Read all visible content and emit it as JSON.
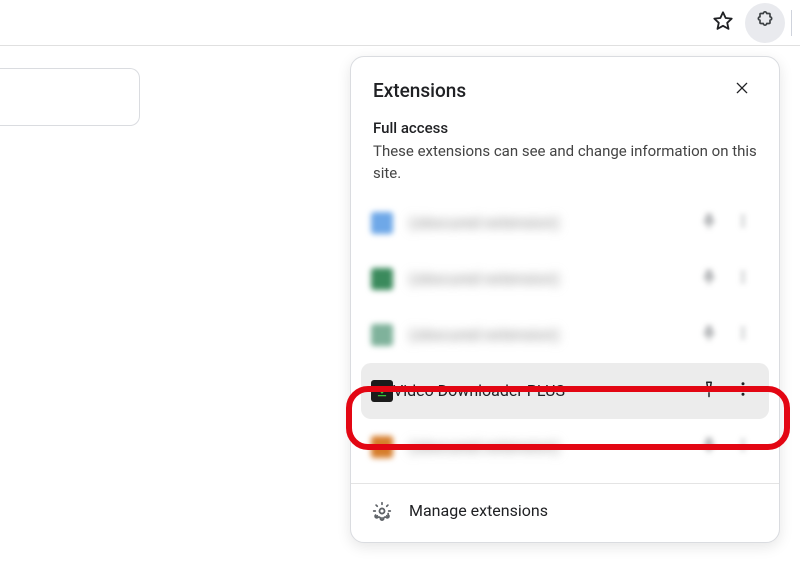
{
  "toolbar": {
    "star_icon": "star",
    "extensions_icon": "puzzle-piece"
  },
  "panel": {
    "title": "Extensions",
    "close_label": "Close",
    "section_heading": "Full access",
    "section_description": "These extensions can see and change information on this site.",
    "footer_label": "Manage extensions"
  },
  "extensions": [
    {
      "name": "(obscured extension)",
      "icon_color": "#6ea8e8",
      "blurred": true
    },
    {
      "name": "(obscured extension)",
      "icon_color": "#3a8a5c",
      "blurred": true
    },
    {
      "name": "(obscured extension)",
      "icon_color": "#7fb29b",
      "blurred": true
    },
    {
      "name": "Video Downloader PLUS",
      "icon_color": "#1b1b1b",
      "blurred": false,
      "highlighted": true
    },
    {
      "name": "(obscured extension)",
      "icon_color": "#d67d2b",
      "blurred": true
    }
  ]
}
